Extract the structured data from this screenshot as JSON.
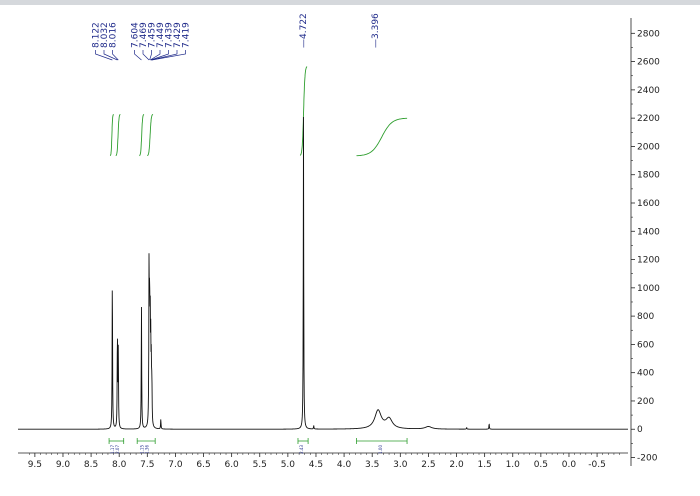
{
  "chart_data": {
    "type": "line",
    "title": "",
    "xlabel": "",
    "ylabel": "",
    "x_axis": {
      "reversed": true,
      "xlim": [
        9.8,
        -1.05
      ],
      "ticks": [
        9.5,
        9.0,
        8.5,
        8.0,
        7.5,
        7.0,
        6.5,
        6.0,
        5.5,
        5.0,
        4.5,
        4.0,
        3.5,
        3.0,
        2.5,
        2.0,
        1.5,
        1.0,
        0.5,
        0.0,
        -0.5
      ]
    },
    "y_axis": {
      "position": "right",
      "ylim": [
        -260,
        2880
      ],
      "ticks": [
        -200,
        0,
        200,
        400,
        600,
        800,
        1000,
        1200,
        1400,
        1600,
        1800,
        2000,
        2200,
        2400,
        2600,
        2800
      ]
    },
    "grid": false,
    "spectrum": {
      "color": "#111111",
      "peaks": [
        {
          "x": 8.122,
          "height": 1100
        },
        {
          "x": 8.032,
          "height": 680
        },
        {
          "x": 8.016,
          "height": 560
        },
        {
          "x": 7.604,
          "height": 880
        },
        {
          "x": 7.469,
          "height": 1120
        },
        {
          "x": 7.459,
          "height": 820
        },
        {
          "x": 7.449,
          "height": 700
        },
        {
          "x": 7.439,
          "height": 520
        },
        {
          "x": 7.429,
          "height": 400
        },
        {
          "x": 7.419,
          "height": 300
        },
        {
          "x": 7.26,
          "height": 70
        },
        {
          "x": 4.722,
          "height": 2210
        },
        {
          "x": 4.54,
          "height": 25
        },
        {
          "x": 3.396,
          "height": 130,
          "broad": true
        },
        {
          "x": 3.2,
          "height": 70,
          "broad": true
        },
        {
          "x": 2.5,
          "height": 18,
          "broad": true
        },
        {
          "x": 1.82,
          "height": 12
        },
        {
          "x": 1.42,
          "height": 40
        }
      ]
    },
    "peak_labels": {
      "color": "#1f2a8a",
      "groups": [
        {
          "labels": [
            "8.122",
            "8.032",
            "8.016"
          ]
        },
        {
          "labels": [
            "7.604",
            "7.469",
            "7.459",
            "7.449",
            "7.439",
            "7.429",
            "7.419"
          ]
        },
        {
          "labels": [
            "4.722"
          ]
        },
        {
          "labels": [
            "3.396"
          ]
        }
      ]
    },
    "integrals": {
      "color": "#2e9e2e",
      "regions": [
        {
          "from": 8.18,
          "to": 7.92,
          "value": "1.17",
          "second_value": "2.07"
        },
        {
          "from": 7.68,
          "to": 7.36,
          "value": "1.15",
          "second_value": "1.36"
        },
        {
          "from": 4.82,
          "to": 4.64,
          "value": "2.43"
        },
        {
          "from": 3.78,
          "to": 2.88,
          "value": "1.00"
        }
      ]
    }
  }
}
